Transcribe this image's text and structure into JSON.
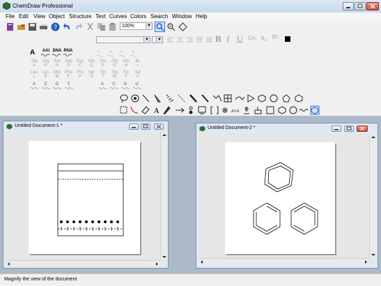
{
  "app": {
    "title": "ChemDraw Professional"
  },
  "menu": {
    "items": [
      "File",
      "Edit",
      "View",
      "Object",
      "Structure",
      "Text",
      "Curves",
      "Colors",
      "Search",
      "Window",
      "Help"
    ]
  },
  "toolbar": {
    "zoom_value": "100%"
  },
  "format_toolbar": {
    "bold": "B",
    "italic": "I",
    "underline": "U",
    "formula": "CH₂",
    "subscript": "X₂",
    "superscript": "X²"
  },
  "templates": {
    "sequence_labels": [
      "AAI",
      "DNA",
      "RNA"
    ],
    "amino_row1": [
      "Ala",
      "Arg",
      "Asn",
      "Asp",
      "Cys",
      "Gln",
      "Glu",
      "Gly",
      "His",
      "Ile"
    ],
    "amino_row1_sub": [
      "A",
      "R",
      "N",
      "D",
      "C",
      "Q",
      "E",
      "G",
      "H",
      "I"
    ],
    "amino_row2": [
      "Leu",
      "Lys",
      "Met",
      "Phe",
      "Pro",
      "Ser",
      "Thr",
      "Trp",
      "Tyr",
      "Val"
    ],
    "amino_row2_sub": [
      "L",
      "K",
      "M",
      "F",
      "P",
      "S",
      "T",
      "W",
      "Y",
      "V"
    ],
    "dna_bases": [
      "A",
      "C",
      "G",
      "T"
    ],
    "rna_bases": [
      "A",
      "C",
      "G",
      "U"
    ]
  },
  "doc1": {
    "title": "Untitled Document-1 *"
  },
  "doc2": {
    "title": "Untitled Document-2 *"
  },
  "status": {
    "text": "Magnify the view of the document"
  },
  "colors": {
    "mdi_bg": "#abb9c8",
    "title_bg": "#c9d9ee",
    "accent_blue": "#1f5fbf"
  }
}
